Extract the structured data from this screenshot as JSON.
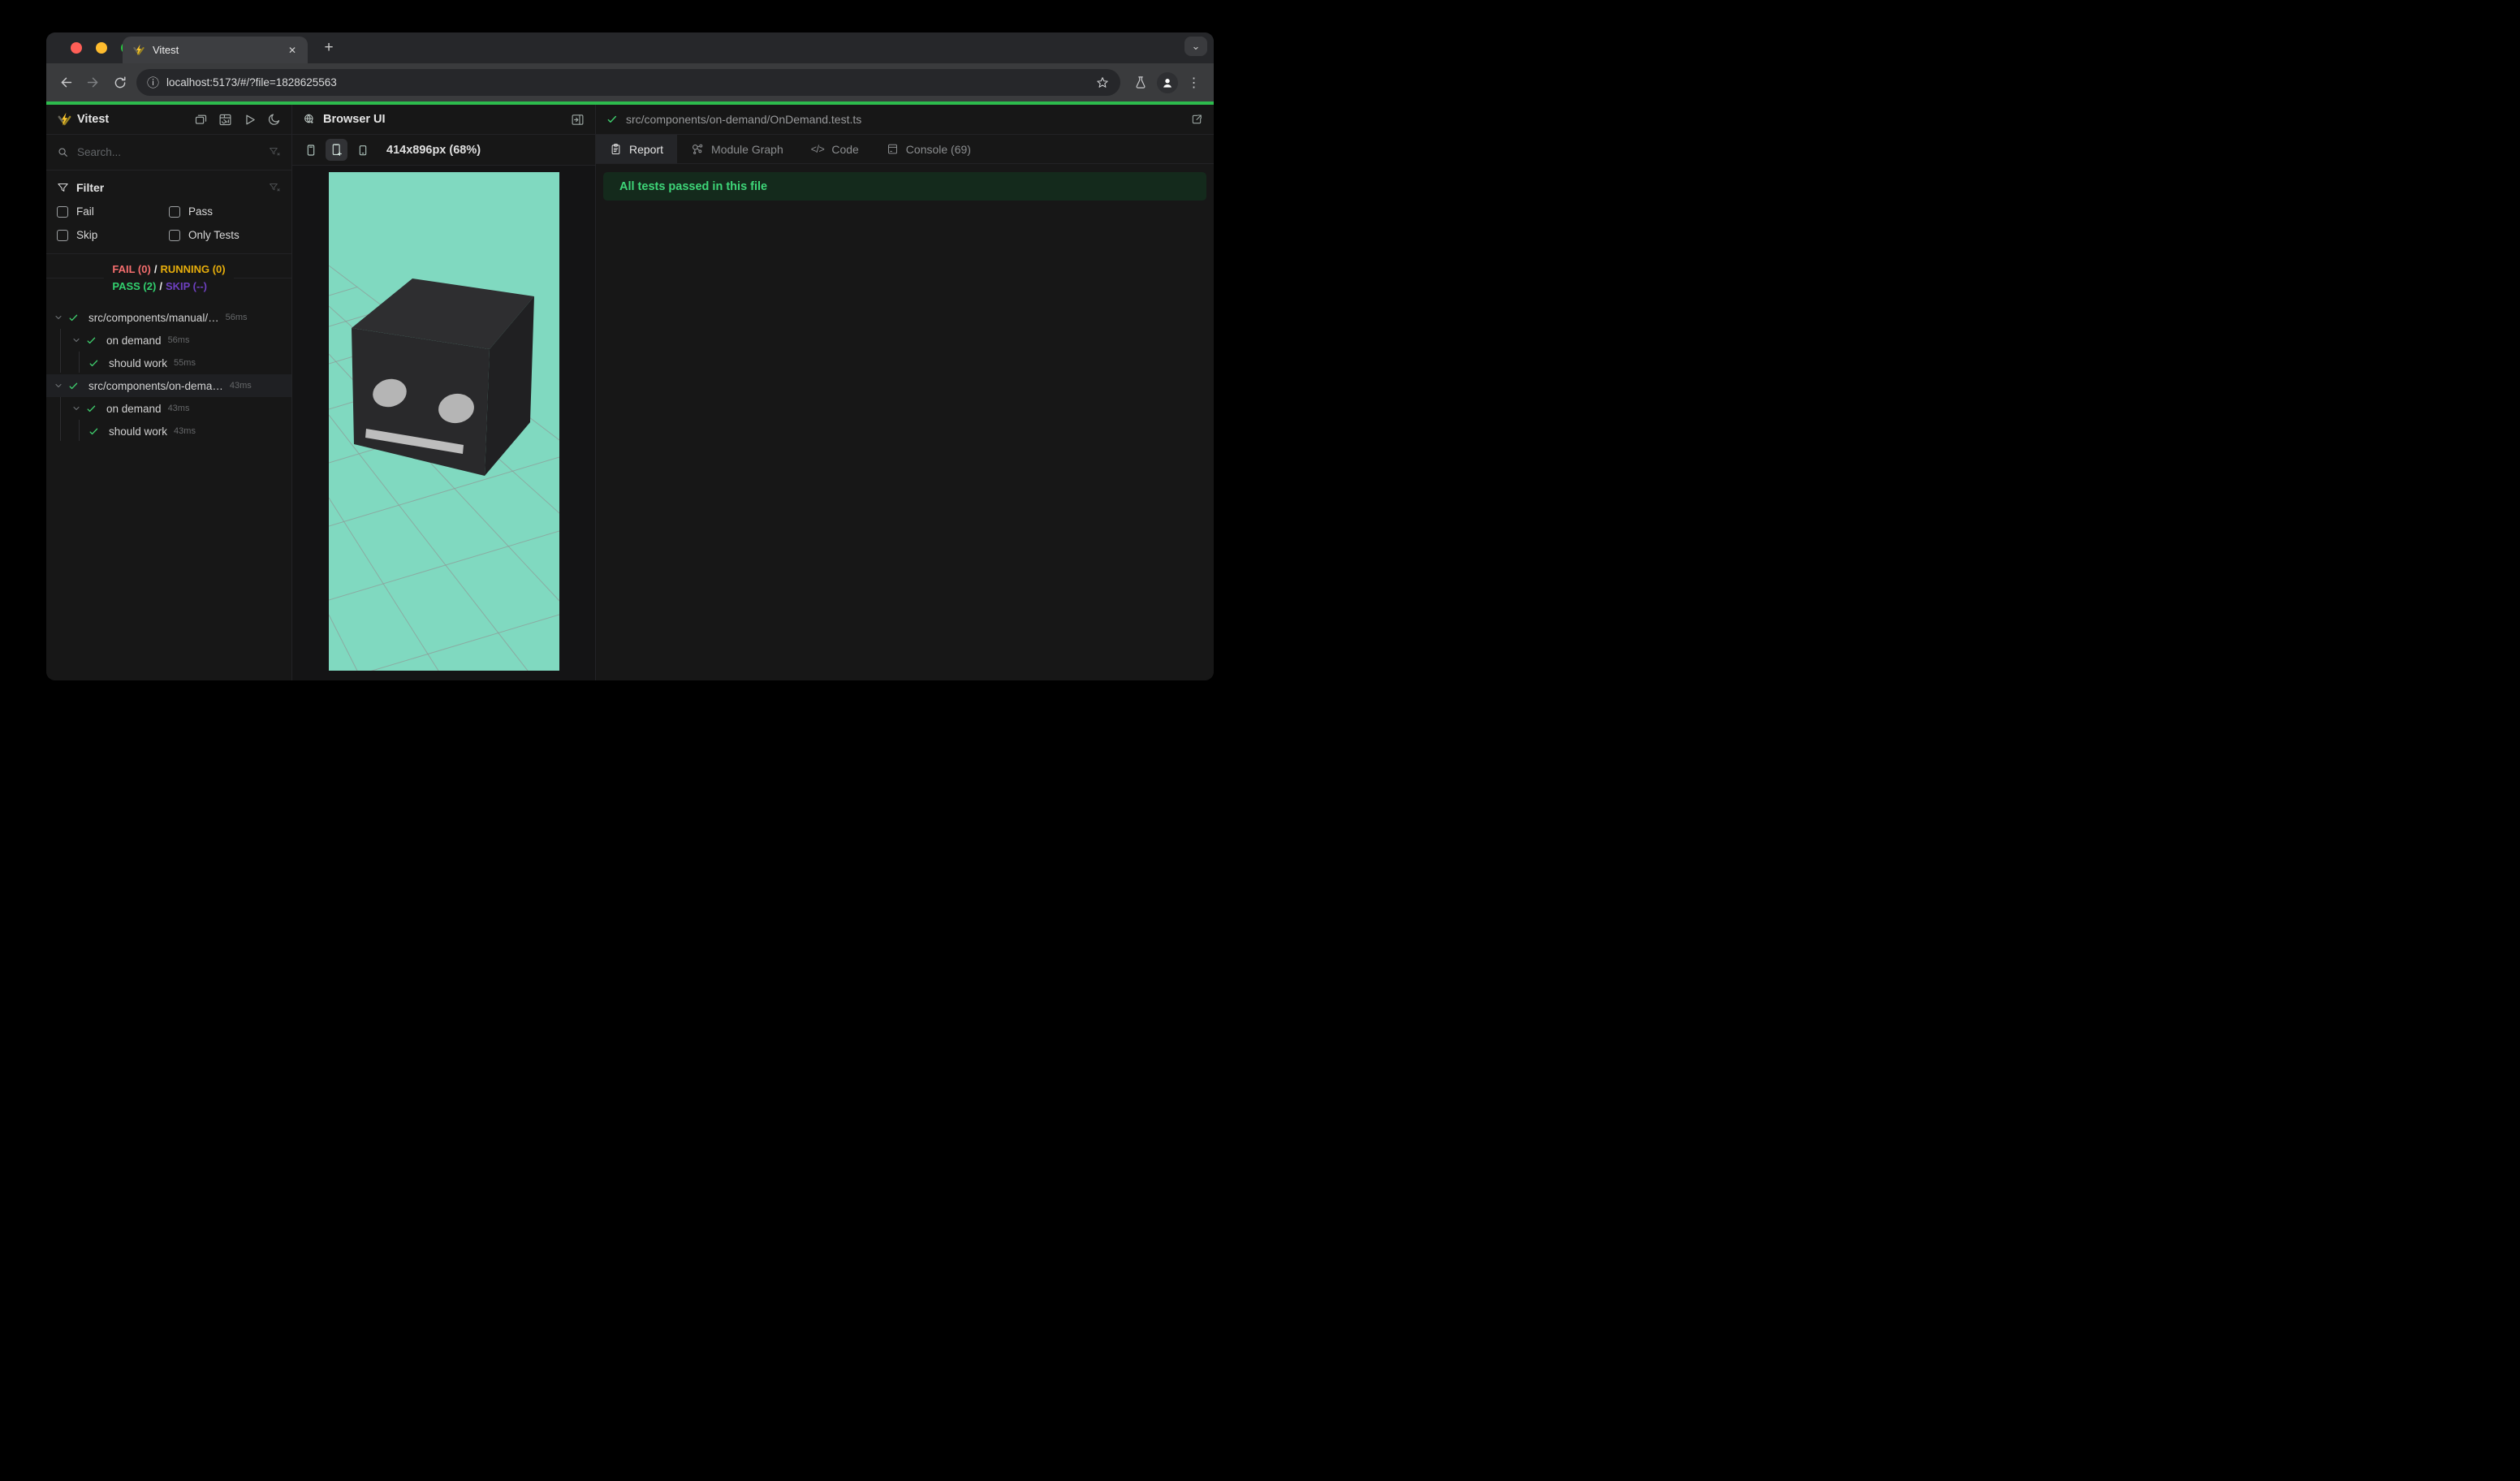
{
  "browser": {
    "tab_title": "Vitest",
    "url": "localhost:5173/#/?file=1828625563"
  },
  "glyphs": {
    "close": "✕",
    "new_tab": "+",
    "tab_search": "⌄",
    "kebab": "⋮",
    "info": "ⓘ",
    "code_tab": "</>"
  },
  "sidebar": {
    "title": "Vitest",
    "search_placeholder": "Search...",
    "filter": {
      "title": "Filter",
      "options": [
        "Fail",
        "Pass",
        "Skip",
        "Only Tests"
      ]
    },
    "summary": {
      "fail": "FAIL (0)",
      "running": "RUNNING (0)",
      "pass": "PASS (2)",
      "skip": "SKIP (--)",
      "separator": "/"
    },
    "tree": [
      {
        "label": "src/components/manual/…",
        "time": "56ms"
      },
      {
        "label": "on demand",
        "time": "56ms"
      },
      {
        "label": "should work",
        "time": "55ms"
      },
      {
        "label": "src/components/on-dema…",
        "time": "43ms"
      },
      {
        "label": "on demand",
        "time": "43ms"
      },
      {
        "label": "should work",
        "time": "43ms"
      }
    ]
  },
  "browser_panel": {
    "title": "Browser UI",
    "dimensions": "414x896px (68%)"
  },
  "report_panel": {
    "file_path": "src/components/on-demand/OnDemand.test.ts",
    "tabs": [
      "Report",
      "Module Graph",
      "Code",
      "Console (69)"
    ],
    "banner": "All tests passed in this file"
  },
  "colors": {
    "progress_green": "#2dbb4d",
    "pass_green": "#32d06e",
    "fail_red": "#f56e6e",
    "running_yellow": "#e7ae0b",
    "skip_purple": "#6e40c0",
    "viewport_bg": "#80d9c0",
    "banner_bg": "#142a1c"
  }
}
